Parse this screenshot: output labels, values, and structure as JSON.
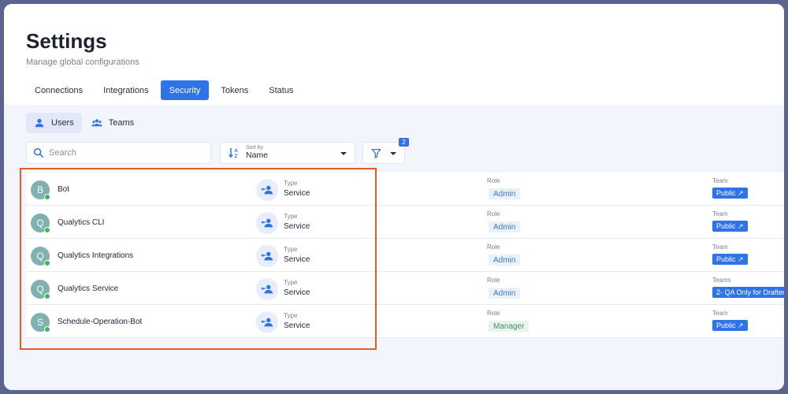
{
  "header": {
    "title": "Settings",
    "subtitle": "Manage global configurations"
  },
  "tabs": [
    {
      "label": "Connections",
      "active": false
    },
    {
      "label": "Integrations",
      "active": false
    },
    {
      "label": "Security",
      "active": true
    },
    {
      "label": "Tokens",
      "active": false
    },
    {
      "label": "Status",
      "active": false
    }
  ],
  "subtabs": [
    {
      "label": "Users",
      "icon": "user-icon",
      "active": true
    },
    {
      "label": "Teams",
      "icon": "team-icon",
      "active": false
    }
  ],
  "search": {
    "placeholder": "Search",
    "value": ""
  },
  "sort": {
    "caption": "Sort by",
    "value": "Name"
  },
  "filter": {
    "badge_count": "2"
  },
  "colors": {
    "accent": "#2f73e8",
    "highlight": "#ea5a24",
    "online": "#3cb94a"
  },
  "rows": [
    {
      "initial": "B",
      "name": "Bot",
      "type_label": "Type",
      "type_value": "Service",
      "role_label": "Role",
      "role": "Admin",
      "team_label": "Team",
      "team": "Public ↗"
    },
    {
      "initial": "Q",
      "name": "Qualytics CLI",
      "type_label": "Type",
      "type_value": "Service",
      "role_label": "Role",
      "role": "Admin",
      "team_label": "Team",
      "team": "Public ↗"
    },
    {
      "initial": "Q",
      "name": "Qualytics Integrations",
      "type_label": "Type",
      "type_value": "Service",
      "role_label": "Role",
      "role": "Admin",
      "team_label": "Team",
      "team": "Public ↗"
    },
    {
      "initial": "Q",
      "name": "Qualytics Service",
      "type_label": "Type",
      "type_value": "Service",
      "role_label": "Role",
      "role": "Admin",
      "team_label": "Teams",
      "team": "2- QA Only for Drafter"
    },
    {
      "initial": "S",
      "name": "Schedule-Operation-Bot",
      "type_label": "Type",
      "type_value": "Service",
      "role_label": "Role",
      "role": "Manager",
      "team_label": "Team",
      "team": "Public ↗"
    }
  ]
}
